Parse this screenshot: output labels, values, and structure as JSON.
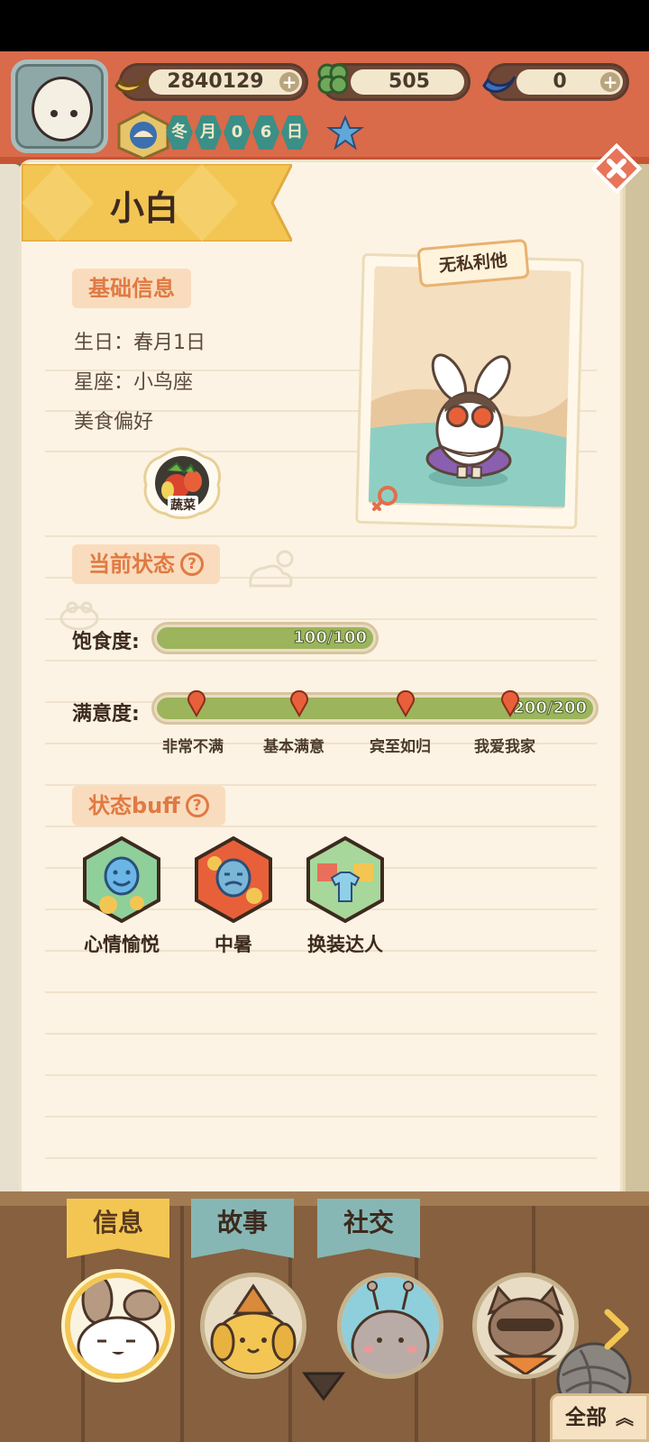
{
  "currencies": {
    "bananas": "2840129",
    "clovers": "505",
    "blue_bananas": "0"
  },
  "date": [
    "冬",
    "月",
    "0",
    "6",
    "日"
  ],
  "character": {
    "name": "小白",
    "tag": "无私利他"
  },
  "basic_info": {
    "title": "基础信息",
    "birthday": "生日：春月1日",
    "constellation": "星座：小鸟座",
    "food_pref_label": "美食偏好",
    "food": "蔬菜"
  },
  "status": {
    "title": "当前状态",
    "help": "?",
    "satiety_label": "饱食度:",
    "satiety_text": "100/100",
    "satiety_value": 100,
    "satiety_max": 100,
    "satisfaction_label": "满意度:",
    "satisfaction_text": "200/200",
    "satisfaction_value": 200,
    "satisfaction_max": 200,
    "milestones": [
      "非常不满",
      "基本满意",
      "宾至如归",
      "我爱我家"
    ]
  },
  "buffs": {
    "title": "状态buff",
    "help": "?",
    "items": [
      {
        "label": "心情愉悦",
        "icon": "happy-face-icon"
      },
      {
        "label": "中暑",
        "icon": "heatstroke-face-icon"
      },
      {
        "label": "换装达人",
        "icon": "wardrobe-icon"
      }
    ]
  },
  "tabs": [
    "信息",
    "故事",
    "社交"
  ],
  "all_button": "全部",
  "colors": {
    "hud_red": "#d96a4a",
    "panel_bg": "#fcf3e4",
    "accent_orange": "#e07a43",
    "bar_green": "#9cb45b",
    "tab_yellow": "#f3c653",
    "tab_teal": "#86b7b5"
  }
}
